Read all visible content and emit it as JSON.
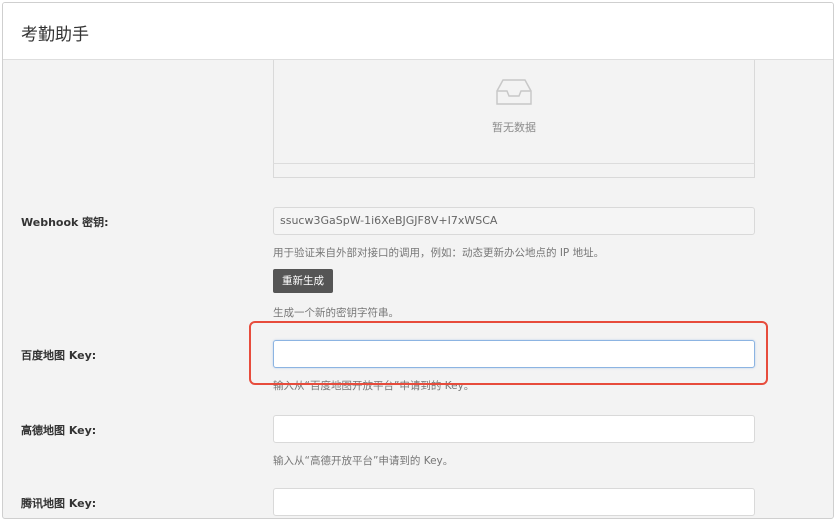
{
  "app": {
    "title": "考勤助手"
  },
  "empty_state": {
    "text": "暂无数据",
    "icon": "inbox-icon"
  },
  "webhook": {
    "label": "Webhook 密钥:",
    "value": "ssucw3GaSpW-1i6XeBJGJF8V+I7xWSCA",
    "help": "用于验证来自外部对接口的调用，例如：动态更新办公地点的 IP 地址。",
    "button_label": "重新生成",
    "button_help": "生成一个新的密钥字符串。"
  },
  "baidu": {
    "label": "百度地图 Key:",
    "value": "",
    "help": "输入从“百度地图开放平台”申请到的 Key。"
  },
  "amap": {
    "label": "高德地图 Key:",
    "value": "",
    "help": "输入从“高德开放平台”申请到的 Key。"
  },
  "tencent": {
    "label": "腾讯地图 Key:",
    "value": ""
  },
  "colors": {
    "highlight": "#e74c3c",
    "button": "#555555",
    "focus": "#8cb4e2"
  }
}
